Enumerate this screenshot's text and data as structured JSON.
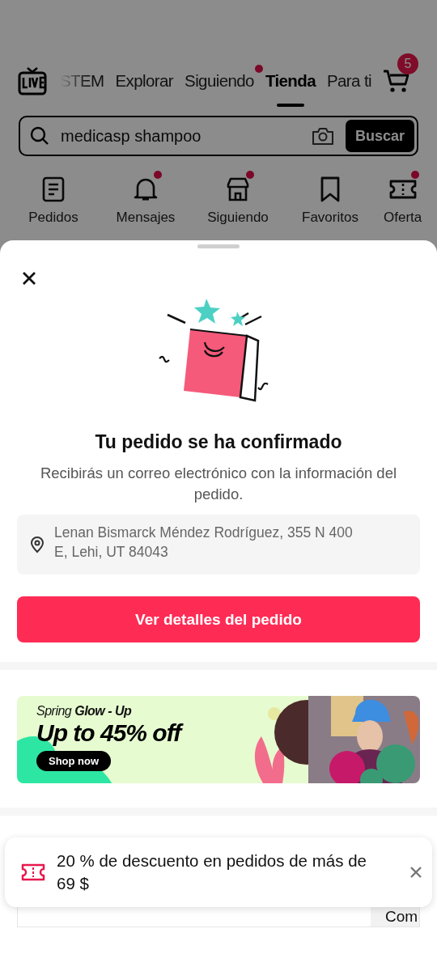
{
  "header": {
    "tabs": [
      {
        "label": "STEM",
        "selected": false,
        "faded": true,
        "dot": false
      },
      {
        "label": "Explorar",
        "selected": false,
        "faded": false,
        "dot": false
      },
      {
        "label": "Siguiendo",
        "selected": false,
        "faded": false,
        "dot": true
      },
      {
        "label": "Tienda",
        "selected": true,
        "faded": false,
        "dot": false
      },
      {
        "label": "Para ti",
        "selected": false,
        "faded": false,
        "dot": false
      }
    ],
    "cart_badge": "5",
    "search": {
      "value": "medicasp shampoo",
      "button": "Buscar"
    },
    "shortcuts": [
      {
        "label": "Pedidos",
        "kind": "orders",
        "dot": false
      },
      {
        "label": "Mensajes",
        "kind": "bell",
        "dot": true
      },
      {
        "label": "Siguiendo",
        "kind": "store",
        "dot": true
      },
      {
        "label": "Favoritos",
        "kind": "bookmark",
        "dot": false
      },
      {
        "label": "Oferta",
        "kind": "ticket",
        "dot": true
      }
    ]
  },
  "sheet": {
    "title": "Tu pedido se ha confirmado",
    "message": "Recibirás un correo electrónico con la información del pedido.",
    "address": "Lenan Bismarck Méndez Rodríguez, 355 N 400 E, Lehi, UT 84043",
    "button": "Ver detalles del pedido",
    "banner": {
      "eyebrow": "Spring **Glow - Up**",
      "headline": "Up to 45% off",
      "button": "Shop now"
    },
    "coupon": {
      "button": "Com"
    }
  },
  "toast": {
    "text": "20 % de descuento en pedidos de más de 69 $"
  }
}
